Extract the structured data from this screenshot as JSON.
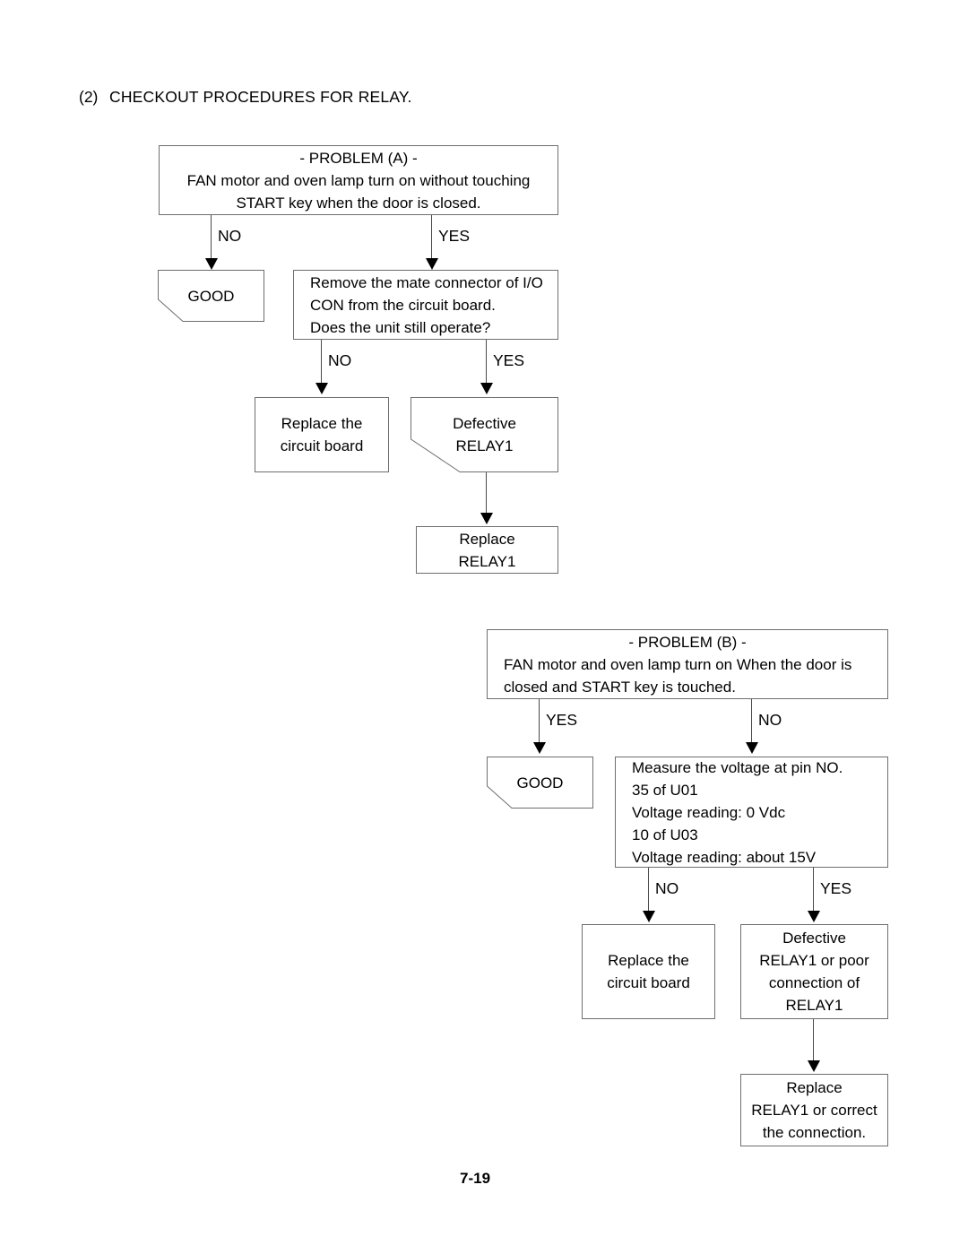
{
  "document": {
    "section_number": "(2)",
    "section_title": "CHECKOUT PROCEDURES FOR RELAY.",
    "page_number": "7-19"
  },
  "problem_a": {
    "problem_box": {
      "title": "- PROBLEM (A) -",
      "line1": "FAN motor and oven lamp turn on without touching",
      "line2": "START key when the door is closed."
    },
    "branch_no": "NO",
    "branch_yes": "YES",
    "good_box": "GOOD",
    "remove_box": {
      "line1": "Remove the mate connector of I/O",
      "line2": "CON from the circuit board.",
      "line3": "Does the unit still operate?"
    },
    "branch2_no": "NO",
    "branch2_yes": "YES",
    "replace_board_box": {
      "line1": "Replace the",
      "line2": "circuit board"
    },
    "defective_relay_box": {
      "line1": "Defective",
      "line2": "RELAY1"
    },
    "replace_relay_box": {
      "line1": "Replace",
      "line2": "RELAY1"
    }
  },
  "problem_b": {
    "problem_box": {
      "title": "- PROBLEM (B) -",
      "line1": "FAN motor and oven lamp turn on When the door is",
      "line2": "closed and START key is touched."
    },
    "branch_yes": "YES",
    "branch_no": "NO",
    "good_box": "GOOD",
    "measure_box": {
      "line1": "Measure the voltage at pin NO.",
      "line2": "35 of U01",
      "line3": "Voltage reading: 0 Vdc",
      "line4": "10 of U03",
      "line5": "Voltage reading: about 15V"
    },
    "branch2_no": "NO",
    "branch2_yes": "YES",
    "replace_board_box": {
      "line1": "Replace the",
      "line2": "circuit board"
    },
    "defective_relay_box": {
      "line1": "Defective",
      "line2": "RELAY1 or poor",
      "line3": "connection of",
      "line4": "RELAY1"
    },
    "replace_relay_box": {
      "line1": "Replace",
      "line2": "RELAY1 or correct",
      "line3": "the connection."
    }
  },
  "colors": {
    "box_border": "#6e6e6e",
    "line": "#4a4a4a",
    "text": "#000000",
    "background": "#ffffff"
  }
}
